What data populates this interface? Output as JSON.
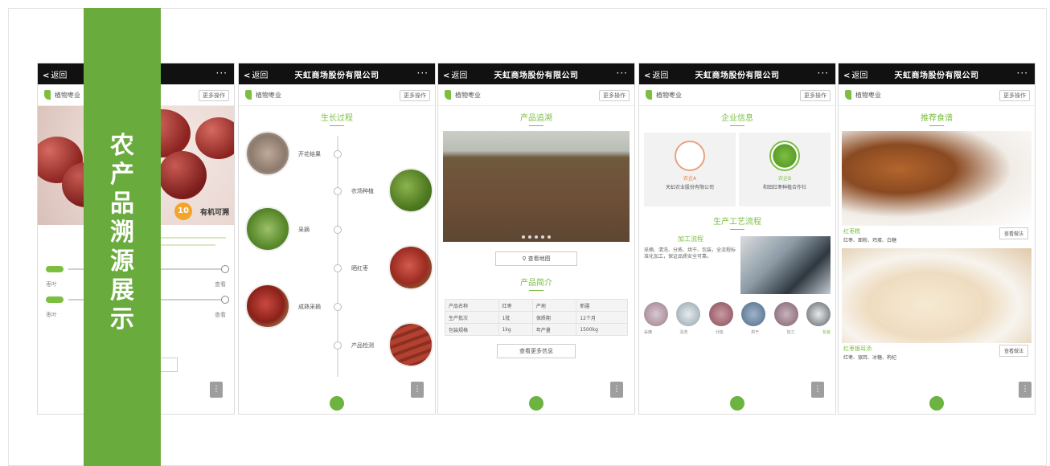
{
  "banner": {
    "chars": [
      "农",
      "产",
      "品",
      "溯",
      "源",
      "展",
      "示"
    ],
    "color": "#6aab3e"
  },
  "common": {
    "back_label": "返回",
    "more_label": "···",
    "company_name": "天虹商场股份有限公司",
    "brand_small": "植物枣业",
    "sub_button": "更多操作"
  },
  "phone1": {
    "badge": "10",
    "hero_caption": "有机可溯",
    "slider_left_1": "枣叶",
    "slider_right_1": "查看",
    "slider_left_2": "枣叶",
    "slider_right_2": "查看"
  },
  "phone2": {
    "section_title": "生长过程",
    "steps": [
      "开花结果",
      "农场种植",
      "采摘",
      "晒红枣",
      "成熟采摘",
      "产品检测"
    ]
  },
  "phone3": {
    "section_title": "产品追溯",
    "map_button": "查看地图",
    "intro_title": "产品简介",
    "rows": [
      [
        "产品名称",
        "红枣",
        "产地",
        "新疆"
      ],
      [
        "生产批次",
        "1批",
        "保质期",
        "12个月"
      ],
      [
        "包装规格",
        "1kg",
        "年产量",
        "1500kg"
      ]
    ],
    "more_button": "查看更多信息"
  },
  "phone4": {
    "section_title": "企业信息",
    "company1_line1": "农企A",
    "company1_line2": "天虹农业股份有限公司",
    "company2_line1": "农企B",
    "company2_line2": "和田红枣种植合作社",
    "craft_title": "生产工艺流程",
    "craft_sub": "加工流程",
    "craft_text": "采摘、清洗、分拣、烘干、包装，全流程标准化加工，保证品质安全可靠。",
    "procs": [
      "采摘",
      "清洗",
      "分拣",
      "烘干",
      "加工",
      "包装"
    ]
  },
  "phone5": {
    "section_title": "推荐食谱",
    "food1_name": "红枣糕",
    "food1_desc": "红枣、面粉、鸡蛋、白糖",
    "food1_btn": "查看做法",
    "food2_name": "红枣银耳汤",
    "food2_desc": "红枣、银耳、冰糖、枸杞",
    "food2_btn": "查看做法"
  }
}
